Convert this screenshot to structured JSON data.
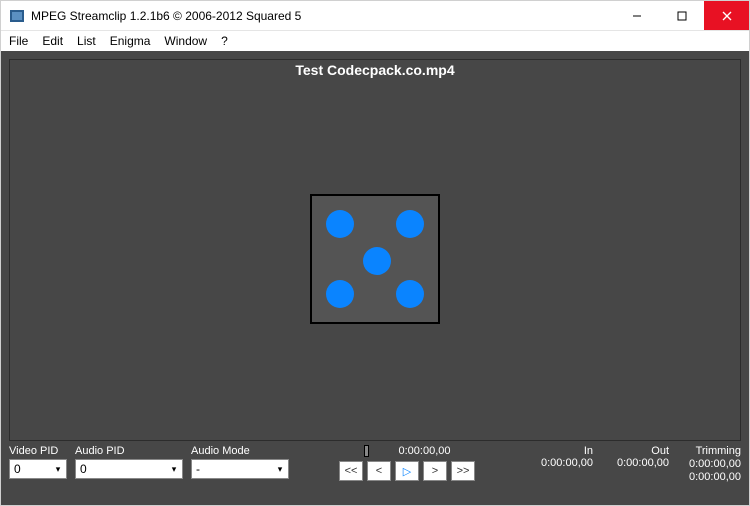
{
  "titlebar": {
    "title": "MPEG Streamclip 1.2.1b6  ©  2006-2012 Squared 5"
  },
  "menu": {
    "file": "File",
    "edit": "Edit",
    "list": "List",
    "enigma": "Enigma",
    "window": "Window",
    "help": "?"
  },
  "video": {
    "title": "Test Codecpack.co.mp4"
  },
  "controls": {
    "video_pid_label": "Video PID",
    "video_pid_value": "0",
    "audio_pid_label": "Audio PID",
    "audio_pid_value": "0",
    "audio_mode_label": "Audio Mode",
    "audio_mode_value": "-"
  },
  "transport": {
    "current_tc": "0:00:00,00",
    "first": "<<",
    "prev": "<",
    "play": "▷",
    "next": ">",
    "last": ">>"
  },
  "tc": {
    "in_label": "In",
    "in_value": "0:00:00,00",
    "out_label": "Out",
    "out_value": "0:00:00,00",
    "trim_label": "Trimming",
    "trim_v1": "0:00:00,00",
    "trim_v2": "0:00:00,00"
  }
}
